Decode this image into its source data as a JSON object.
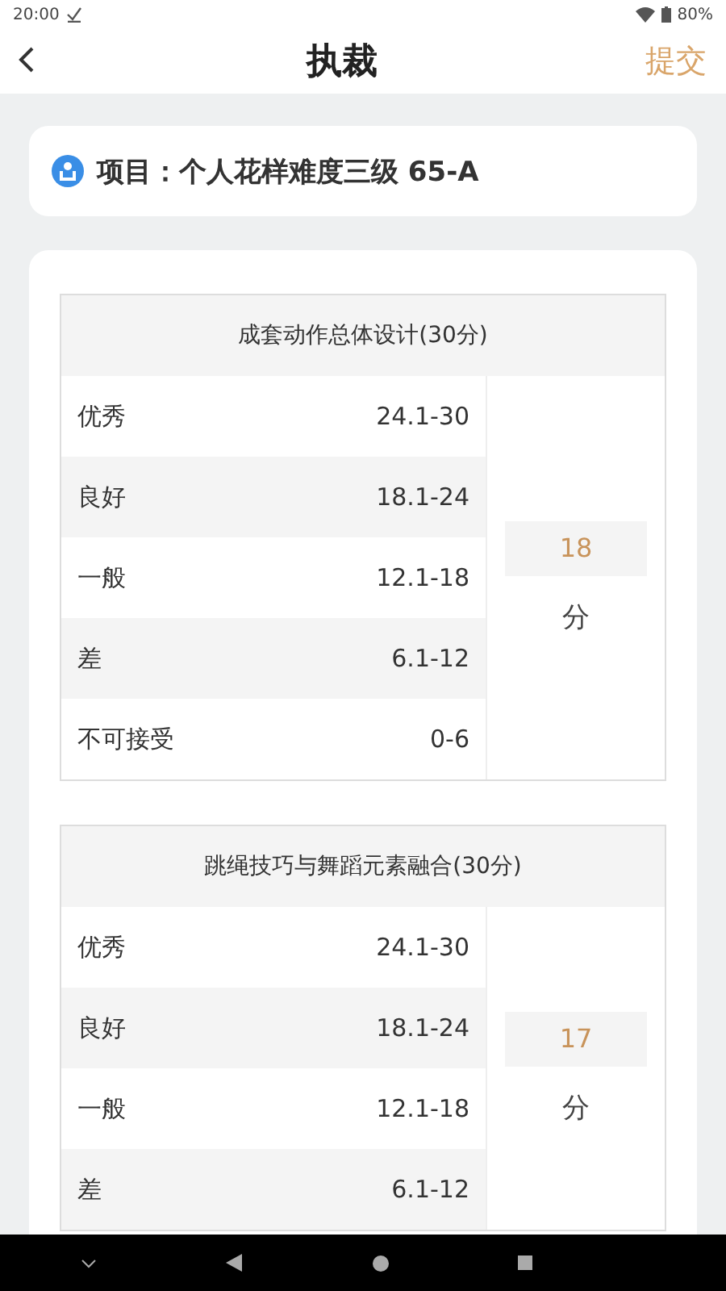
{
  "status_bar": {
    "time": "20:00",
    "battery": "80%"
  },
  "header": {
    "title": "执裁",
    "action": "提交"
  },
  "project": {
    "label": "项目：个人花样难度三级 65-A"
  },
  "sections": [
    {
      "title": "成套动作总体设计(30分)",
      "score": "18",
      "unit": "分",
      "rows": [
        {
          "grade": "优秀",
          "range": "24.1-30"
        },
        {
          "grade": "良好",
          "range": "18.1-24"
        },
        {
          "grade": "一般",
          "range": "12.1-18"
        },
        {
          "grade": "差",
          "range": "6.1-12"
        },
        {
          "grade": "不可接受",
          "range": "0-6"
        }
      ]
    },
    {
      "title": "跳绳技巧与舞蹈元素融合(30分)",
      "score": "17",
      "unit": "分",
      "rows": [
        {
          "grade": "优秀",
          "range": "24.1-30"
        },
        {
          "grade": "良好",
          "range": "18.1-24"
        },
        {
          "grade": "一般",
          "range": "12.1-18"
        },
        {
          "grade": "差",
          "range": "6.1-12"
        }
      ]
    }
  ]
}
